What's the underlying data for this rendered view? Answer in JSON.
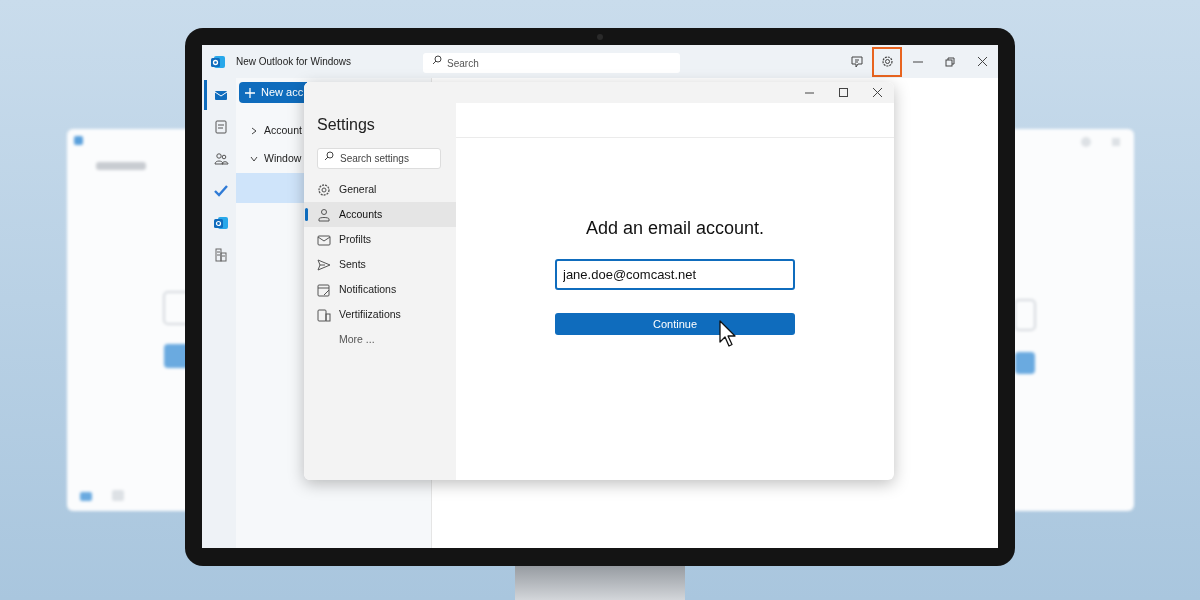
{
  "app": {
    "title": "New Outlook for Windows",
    "search_placeholder": "Search",
    "settings_highlighted": true
  },
  "rail": [
    {
      "kind": "mail",
      "selected": true
    },
    {
      "kind": "notes",
      "selected": false
    },
    {
      "kind": "people",
      "selected": false
    },
    {
      "kind": "todo",
      "selected": false
    },
    {
      "kind": "outlook",
      "selected": false
    },
    {
      "kind": "apps",
      "selected": false
    }
  ],
  "new_button": "New acc",
  "folders": [
    {
      "label": "Account",
      "expanded": false
    },
    {
      "label": "Window",
      "expanded": true
    }
  ],
  "settings": {
    "title": "Settings",
    "search_placeholder": "Search settings",
    "nav": [
      {
        "label": "General",
        "kind": "gear",
        "selected": false
      },
      {
        "label": "Accounts",
        "kind": "person",
        "selected": true
      },
      {
        "label": "Profilts",
        "kind": "mail",
        "selected": false
      },
      {
        "label": "Sents",
        "kind": "send",
        "selected": false
      },
      {
        "label": "Notifications",
        "kind": "note",
        "selected": false
      },
      {
        "label": "Vertifiizations",
        "kind": "device",
        "selected": false
      },
      {
        "label": "More ...",
        "kind": "none",
        "selected": false
      }
    ],
    "heading": "Add an email account.",
    "email": "jane.doe@comcast.net",
    "button": "Continue"
  }
}
